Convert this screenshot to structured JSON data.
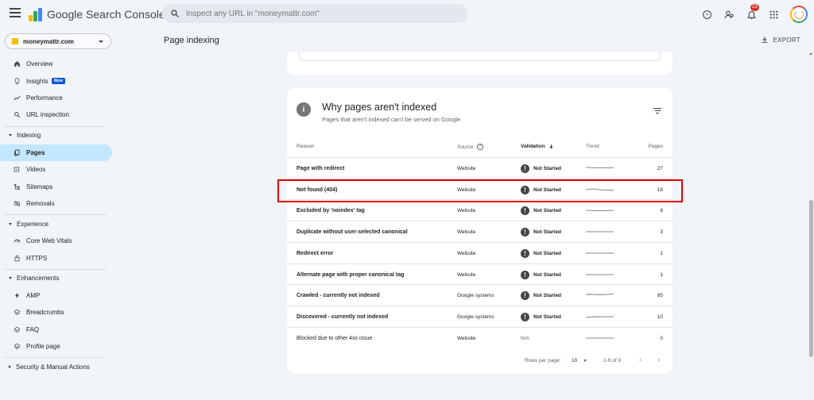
{
  "app": {
    "title": "Google Search Console",
    "search_placeholder": "Inspect any URL in \"moneymattr.com\"",
    "notification_count": "23"
  },
  "property": {
    "name": "moneymattr.com"
  },
  "page": {
    "title": "Page indexing",
    "export_label": "EXPORT"
  },
  "sidebar": {
    "top_items": [
      {
        "label": "Overview",
        "icon": "home-icon"
      },
      {
        "label": "Insights",
        "icon": "lightbulb-icon",
        "badge": "New"
      },
      {
        "label": "Performance",
        "icon": "trending-up-icon"
      },
      {
        "label": "URL inspection",
        "icon": "search-icon"
      }
    ],
    "indexing": {
      "label": "Indexing",
      "items": [
        {
          "label": "Pages",
          "icon": "pages-icon",
          "active": true
        },
        {
          "label": "Videos",
          "icon": "video-icon"
        },
        {
          "label": "Sitemaps",
          "icon": "sitemap-icon"
        },
        {
          "label": "Removals",
          "icon": "visibility-off-icon"
        }
      ]
    },
    "experience": {
      "label": "Experience",
      "items": [
        {
          "label": "Core Web Vitals",
          "icon": "speed-icon"
        },
        {
          "label": "HTTPS",
          "icon": "lock-icon"
        }
      ]
    },
    "enhancements": {
      "label": "Enhancements",
      "items": [
        {
          "label": "AMP",
          "icon": "bolt-icon"
        },
        {
          "label": "Breadcrumbs",
          "icon": "layers-icon"
        },
        {
          "label": "FAQ",
          "icon": "layers-icon"
        },
        {
          "label": "Profile page",
          "icon": "layers-icon"
        }
      ]
    },
    "security": {
      "label": "Security & Manual Actions"
    }
  },
  "card": {
    "title": "Why pages aren't indexed",
    "subtitle": "Pages that aren't indexed can't be served on Google",
    "columns": {
      "reason": "Reason",
      "source": "Source",
      "validation": "Validation",
      "trend": "Trend",
      "pages": "Pages"
    },
    "rows": [
      {
        "reason": "Page with redirect",
        "source": "Website",
        "validation": "Not Started",
        "pages": "27",
        "trend": [
          4,
          4,
          4.5,
          4.5,
          4.5,
          4.5,
          4.5,
          4.5,
          4.5
        ]
      },
      {
        "reason": "Not found (404)",
        "source": "Website",
        "validation": "Not Started",
        "pages": "18",
        "trend": [
          5,
          4.5,
          4,
          4.5,
          5,
          5.2,
          5.5,
          5.8,
          5.8
        ]
      },
      {
        "reason": "Excluded by 'noindex' tag",
        "source": "Website",
        "validation": "Not Started",
        "pages": "6",
        "trend": [
          5,
          5,
          5.2,
          5.5,
          5.5,
          5.5,
          5.5,
          5,
          5
        ]
      },
      {
        "reason": "Duplicate without user-selected canonical",
        "source": "Website",
        "validation": "Not Started",
        "pages": "3",
        "trend": [
          5,
          5,
          5,
          5,
          5,
          5,
          5,
          5,
          5
        ]
      },
      {
        "reason": "Redirect error",
        "source": "Website",
        "validation": "Not Started",
        "pages": "1",
        "trend": [
          5,
          5,
          5,
          5,
          5,
          5,
          5,
          5,
          5
        ]
      },
      {
        "reason": "Alternate page with proper canonical tag",
        "source": "Website",
        "validation": "Not Started",
        "pages": "1",
        "trend": [
          5,
          5,
          5,
          5,
          5,
          5,
          5,
          5,
          5
        ]
      },
      {
        "reason": "Crawled - currently not indexed",
        "source": "Google systems",
        "validation": "Not Started",
        "pages": "95",
        "trend": [
          4,
          3.8,
          4,
          4.2,
          4.2,
          4.2,
          4,
          3.8,
          3
        ]
      },
      {
        "reason": "Discovered - currently not indexed",
        "source": "Google systems",
        "validation": "Not Started",
        "pages": "10",
        "trend": [
          6,
          5.5,
          5,
          5.2,
          5,
          5.2,
          5,
          5,
          5
        ]
      },
      {
        "reason": "Blocked due to other 4xx issue",
        "source": "Website",
        "validation": "N/A",
        "pages": "0",
        "trend": [
          5,
          5,
          5,
          5,
          5,
          5,
          5,
          5,
          5
        ]
      }
    ],
    "footer": {
      "rows_per_page_label": "Rows per page:",
      "rows_per_page": "10",
      "range": "1-9 of 9"
    }
  },
  "colors": {
    "active_nav": "#c2e7ff",
    "highlight": "#e00000",
    "badge": "#0b57d0"
  }
}
